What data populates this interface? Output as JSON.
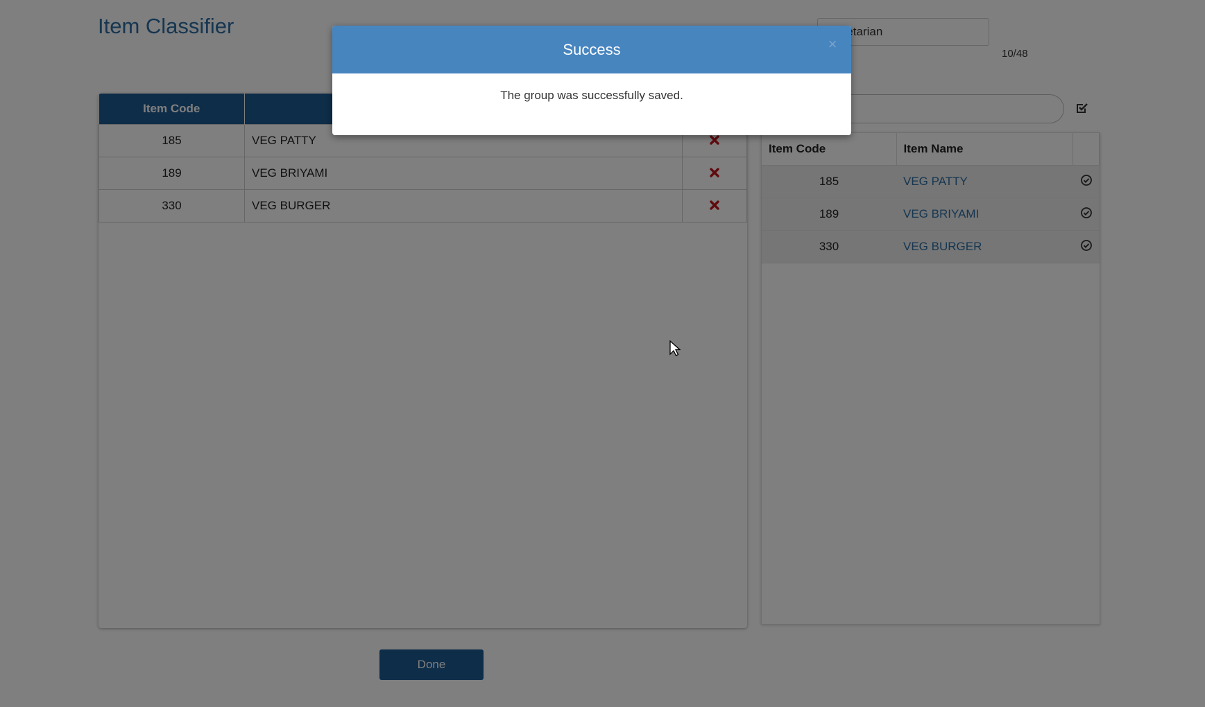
{
  "app": {
    "title": "Item Classifier"
  },
  "group": {
    "name_value": "Vegetarian",
    "counter": "10/48"
  },
  "search": {
    "value": "",
    "placeholder": ""
  },
  "left_table": {
    "headers": [
      "Item Code",
      "",
      ""
    ],
    "rows": [
      {
        "code": "185",
        "name": "VEG PATTY"
      },
      {
        "code": "189",
        "name": "VEG BRIYAMI"
      },
      {
        "code": "330",
        "name": "VEG BURGER"
      }
    ]
  },
  "right_table": {
    "headers": [
      "Item Code",
      "Item Name",
      ""
    ],
    "rows": [
      {
        "code": "185",
        "name": "VEG PATTY"
      },
      {
        "code": "189",
        "name": "VEG BRIYAMI"
      },
      {
        "code": "330",
        "name": "VEG BURGER"
      }
    ]
  },
  "footer": {
    "done_label": "Done"
  },
  "modal": {
    "title": "Success",
    "close_glyph": "×",
    "message": "The group was successfully saved."
  },
  "icons": {
    "remove": "close-x-icon",
    "select": "check-circle-icon",
    "select_all": "check-square-icon"
  },
  "colors": {
    "brand": "#1d5a92",
    "modal_header": "#4785bf",
    "link": "#2d6da3",
    "danger": "#c0141c"
  }
}
